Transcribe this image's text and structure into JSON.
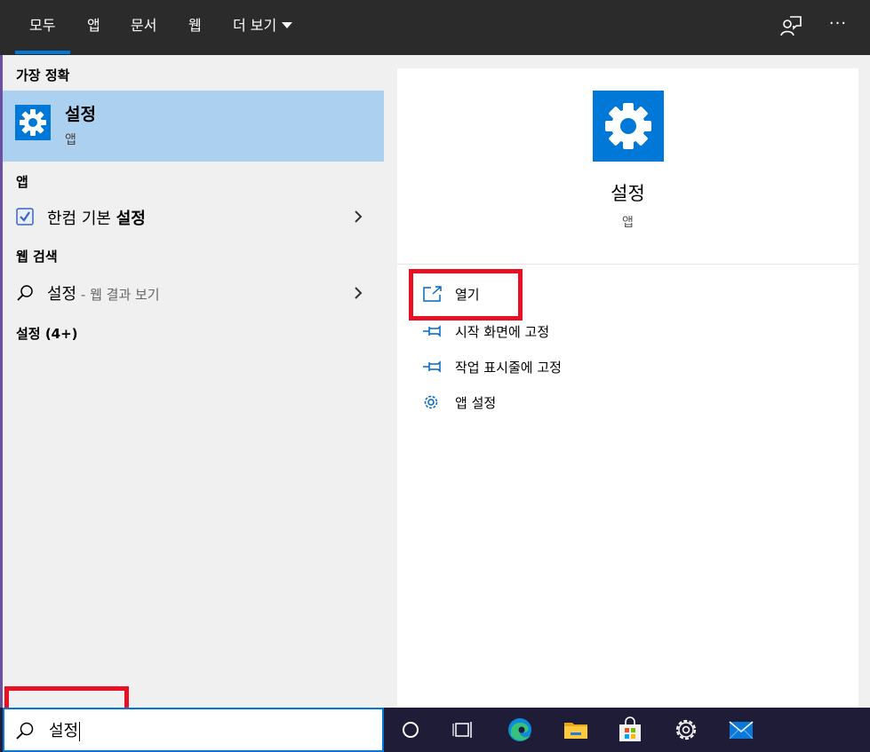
{
  "tabs": [
    {
      "label": "모두",
      "active": true
    },
    {
      "label": "앱"
    },
    {
      "label": "문서"
    },
    {
      "label": "웹"
    },
    {
      "label": "더 보기"
    }
  ],
  "header_icons": {
    "feedback": "feedback-icon",
    "more": "···"
  },
  "left": {
    "best_match_heading": "가장 정확",
    "best_match": {
      "title": "설정",
      "subtitle": "앱",
      "icon": "gear-icon"
    },
    "apps_heading": "앱",
    "app_item": {
      "text_prefix": "한컴 기본 ",
      "text_bold": "설정",
      "icon": "checklist-icon"
    },
    "web_heading": "웹 검색",
    "web_item": {
      "text": "설정",
      "suffix": " - 웹 결과 보기",
      "icon": "search-icon"
    },
    "settings_heading": "설정 (4+)"
  },
  "right": {
    "title": "설정",
    "subtitle": "앱",
    "actions": [
      {
        "label": "열기",
        "icon": "open-icon"
      },
      {
        "label": "시작 화면에 고정",
        "icon": "pin-icon"
      },
      {
        "label": "작업 표시줄에 고정",
        "icon": "pin-icon"
      },
      {
        "label": "앱 설정",
        "icon": "gear-icon"
      }
    ]
  },
  "search": {
    "value": "설정"
  },
  "taskbar": [
    "cortana-icon",
    "task-view-icon",
    "edge-icon",
    "file-explorer-icon",
    "store-icon",
    "settings-icon",
    "mail-icon"
  ],
  "colors": {
    "accent": "#0078d7",
    "highlight": "#e81123",
    "selected": "#acd0f0"
  }
}
